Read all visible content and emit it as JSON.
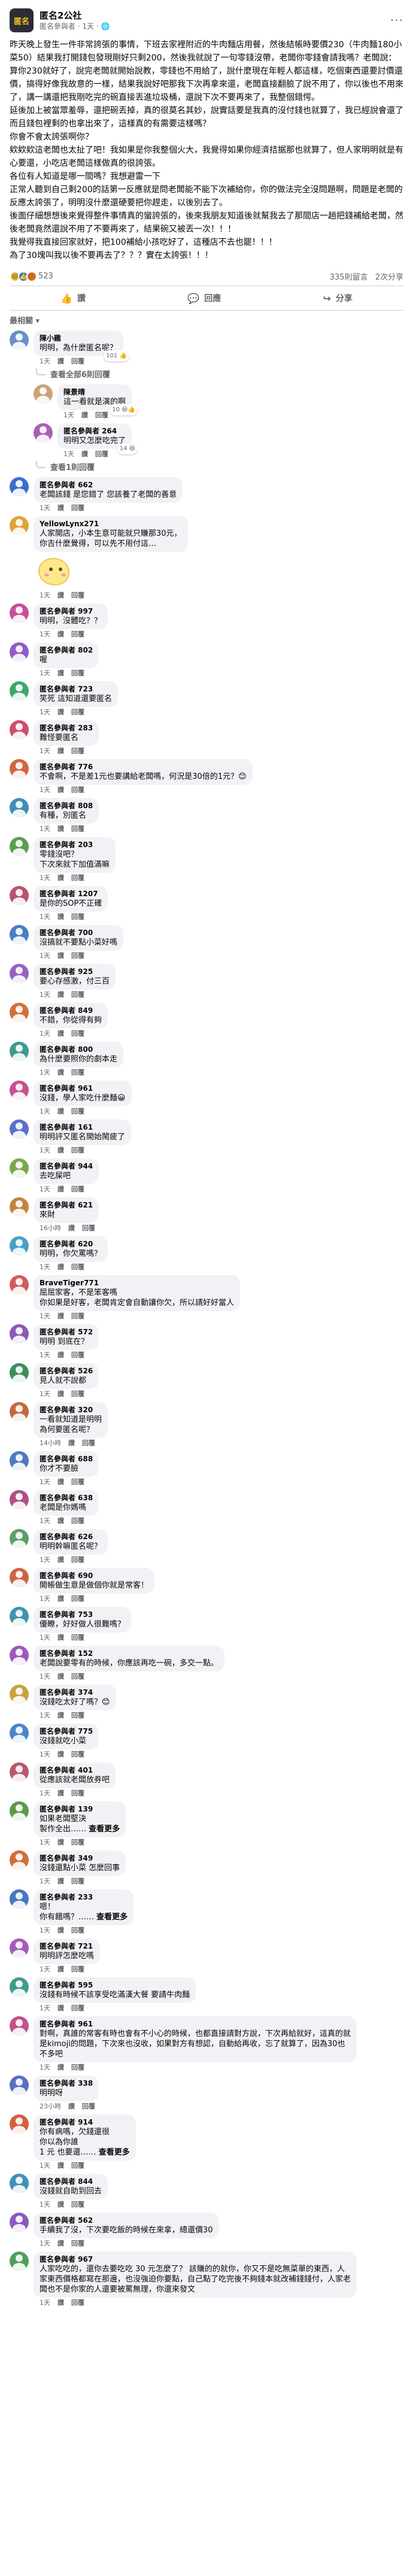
{
  "post": {
    "group_name": "匿名2公社",
    "author": "匿名參與者",
    "time": "1天",
    "paragraphs": [
      "昨天晚上發生一件非常誇張的事情，下班去家裡附近的牛肉麵店用餐，然後結帳時要價230（牛肉麵180小菜50）結果我打開錢包發現剛好只剩200，然後我就說了一句零錢沒帶，老闆你零錢會請我嗎？老闆說：算你230就好了，說完老闆就開始說教，零錢也不用給了，說什麼現在年輕人都這樣，吃個東西還要討價還價，搞得好像我故意的一樣，結果我說好吧那我下次再拿來還，老闆直接翻臉了說不用了，你以後也不用來了，講一講還把我剛吃完的碗直接丟進垃圾桶，還說下次不要再來了，我整個錯愕。",
      "延後加上被當眾羞辱，還把碗丟掉，真的很莫名其妙，說實話要是我真的沒付錢也就算了，我已經說會還了而且錢包裡剩的也拿出來了，這樣真的有需要這樣嗎？",
      "你會不會太誇張啊你？",
      "欸欸欸這老闆也太扯了吧！我如果是你我整個火大，我覺得如果你經濟拮据那也就算了，但人家明明就是有心要還，小吃店老闆這樣做真的很誇張。",
      "各位有人知道是哪一間嗎？我想避雷一下",
      "正常人聽到自己剩200的話第一反應就是問老闆能不能下次補給你，你的做法完全沒問題啊，問題是老闆的反應太誇張了，明明沒什麼還硬要把你趕走，以後別去了。",
      "後面仔細想想後來覺得整件事情真的蠻誇張的，後來我朋友知道後就幫我去了那間店一趟把錢補給老闆，然後老闆竟然還說不用了不要再來了，結果碗又被丟一次！！！",
      "我覺得我直接回家就好，把100補給小孩吃好了，這種店不去也罷！！！",
      "為了30塊叫我以後不要再去了？？？實在太誇張！！！"
    ],
    "reaction_count": "523",
    "comment_count": "335則留言",
    "share_count": "2次分享",
    "like_label": "讚",
    "comment_label": "回應",
    "share_label": "分享",
    "sort_label": "最相關 ▾",
    "icons": {
      "more": "more-horizontal-icon",
      "like": "thumbs-up-icon",
      "comment": "speech-bubble-icon",
      "share": "share-arrow-icon"
    }
  },
  "view_replies": [
    "查看全部6則回覆",
    "查看1則回覆"
  ],
  "comments": [
    {
      "name": "陳小雞",
      "text": "明明，為什麼匿名呢？",
      "time": "1天",
      "reply": false,
      "react": "101 👍",
      "color": "#6b8fc7"
    },
    {
      "name": "陳景晴",
      "text": "這一看就是演的啊",
      "time": "1天",
      "reply": true,
      "react": "10 😆👍",
      "color": "#c9a27a"
    },
    {
      "name": "匿名參與者 264",
      "text": "明明又怎麼吃完了",
      "time": "1天",
      "reply": true,
      "react": "14 😆",
      "color": "#a85fb5"
    },
    {
      "name": "匿名參與者 662",
      "text": "老闆該錢 是您錯了 您該養了老闆的善意",
      "time": "1天",
      "reply": false,
      "react": "",
      "color": "#3d6ecf"
    },
    {
      "name": "YellowLynx271",
      "text": "人家開店，小本生意可能就只賺那30元，\n你吉什麼覺得，可以先不用付這…",
      "time": "1天",
      "reply": false,
      "react": "",
      "color": "#e0a33a",
      "sticker": true
    },
    {
      "name": "匿名參與者 997",
      "text": "明明，沒體吃？？",
      "time": "1天",
      "reply": false,
      "react": "",
      "color": "#c74f9a"
    },
    {
      "name": "匿名參與者 802",
      "text": "喔",
      "time": "1天",
      "reply": false,
      "react": "",
      "color": "#8e5cc9"
    },
    {
      "name": "匿名參與者 723",
      "text": "笑死 這知道還要匿名",
      "time": "1天",
      "reply": false,
      "react": "",
      "color": "#3fa66b"
    },
    {
      "name": "匿名參與者 283",
      "text": "難怪要匿名",
      "time": "1天",
      "reply": false,
      "react": "",
      "color": "#c94f6d"
    },
    {
      "name": "匿名參與者 776",
      "text": "不會啊，不是差1元也要講給老闆嗎，何況是30倍的1元？😊",
      "time": "1天",
      "reply": false,
      "react": "",
      "color": "#d1683b"
    },
    {
      "name": "匿名參與者 808",
      "text": "有種，別匿名",
      "time": "1天",
      "reply": false,
      "react": "",
      "color": "#3f8fb5"
    },
    {
      "name": "匿名參與者 203",
      "text": "零錢沒吧？\n下次來就下加值滿嘛",
      "time": "1天",
      "reply": false,
      "react": "",
      "color": "#5a9e4f"
    },
    {
      "name": "匿名參與者 1207",
      "text": "是你的SOP不正確",
      "time": "1天",
      "reply": false,
      "react": "",
      "color": "#b8546a"
    },
    {
      "name": "匿名參與者 700",
      "text": "沒搞就不要點小菜好嗎",
      "time": "1天",
      "reply": false,
      "react": "",
      "color": "#4a7ec4"
    },
    {
      "name": "匿名參與者 925",
      "text": "要心存感激，付三百",
      "time": "1天",
      "reply": false,
      "react": "",
      "color": "#9463c2"
    },
    {
      "name": "匿名參與者 849",
      "text": "不錯，你從得有夠",
      "time": "1天",
      "reply": false,
      "react": "",
      "color": "#d0713a"
    },
    {
      "name": "匿名參與者 800",
      "text": "為什麼要照你的劇本走",
      "time": "1天",
      "reply": false,
      "react": "",
      "color": "#3b9c8e"
    },
    {
      "name": "匿名參與者 961",
      "text": "沒錢，學人家吃什麼麵😀",
      "time": "1天",
      "reply": false,
      "react": "",
      "color": "#c45390"
    },
    {
      "name": "匿名參與者 161",
      "text": "明明評又匿名開始鬧疲了",
      "time": "1天",
      "reply": false,
      "react": "",
      "color": "#5c6fc8"
    },
    {
      "name": "匿名參與者 944",
      "text": "去吃屎吧",
      "time": "1天",
      "reply": false,
      "react": "",
      "color": "#7aa84a"
    },
    {
      "name": "匿名參與者 621",
      "text": "來財",
      "time": "16小時",
      "reply": false,
      "react": "",
      "color": "#c4843a"
    },
    {
      "name": "匿名參與者 620",
      "text": "明明，你欠罵嗎？",
      "time": "1天",
      "reply": false,
      "react": "",
      "color": "#49a0c7"
    },
    {
      "name": "BraveTiger771",
      "text": "屈屈家客，不是笨客嗎\n你如果是好客，老闆肯定會自動讓你欠，所以請好好當人",
      "time": "1天",
      "reply": false,
      "react": "",
      "color": "#d25a5a"
    },
    {
      "name": "匿名參與者 572",
      "text": "明明 到底在？",
      "time": "1天",
      "reply": false,
      "react": "",
      "color": "#8d5ab8"
    },
    {
      "name": "匿名參與者 526",
      "text": "見人就不說都",
      "time": "1天",
      "reply": false,
      "react": "",
      "color": "#3e8d5d"
    },
    {
      "name": "匿名參與者 320",
      "text": "一看就知道是明明\n為何要匿名呢？",
      "time": "14小時",
      "reply": false,
      "react": "",
      "color": "#c26a3e"
    },
    {
      "name": "匿名參與者 688",
      "text": "你才不要臉",
      "time": "1天",
      "reply": false,
      "react": "",
      "color": "#4e78c0"
    },
    {
      "name": "匿名參與者 638",
      "text": "老闆是你媽嗎",
      "time": "1天",
      "reply": false,
      "react": "",
      "color": "#b04f88"
    },
    {
      "name": "匿名參與者 626",
      "text": "明明幹嘛匿名呢？",
      "time": "1天",
      "reply": false,
      "react": "",
      "color": "#5aa06a"
    },
    {
      "name": "匿名參與者 690",
      "text": "開帳做生意是做個你就是常客！",
      "time": "1天",
      "reply": false,
      "react": "",
      "color": "#ca6544"
    },
    {
      "name": "匿名參與者 753",
      "text": "優瞭，好好做人很難嗎？",
      "time": "1天",
      "reply": false,
      "react": "",
      "color": "#3f94ad"
    },
    {
      "name": "匿名參與者 152",
      "text": "老闆說要零有的時候，你應該再吃一碗，多交一點。",
      "time": "1天",
      "reply": false,
      "react": "",
      "color": "#9a59bf"
    },
    {
      "name": "匿名參與者 374",
      "text": "沒錢吃太好了嗎？😊",
      "time": "1天",
      "reply": false,
      "react": "",
      "color": "#c9a23e"
    },
    {
      "name": "匿名參與者 775",
      "text": "沒錢就吃小菜",
      "time": "1天",
      "reply": false,
      "react": "",
      "color": "#4b86c9"
    },
    {
      "name": "匿名參與者 401",
      "text": "從應該就老闆放券吧",
      "time": "1天",
      "reply": false,
      "react": "",
      "color": "#b8586f"
    },
    {
      "name": "匿名參與者 139",
      "text": "如果老闆堅決\n製作全出……",
      "time": "1天",
      "reply": false,
      "react": "",
      "color": "#5d9a45",
      "more": true
    },
    {
      "name": "匿名參與者 349",
      "text": "沒錢還點小菜 怎麼回事",
      "time": "1天",
      "reply": false,
      "react": "",
      "color": "#cf6f3a"
    },
    {
      "name": "匿名參與者 233",
      "text": "嗯！\n你有餓嗎？……",
      "time": "1天",
      "reply": false,
      "react": "",
      "color": "#4677bd",
      "more": true
    },
    {
      "name": "匿名參與者 721",
      "text": "明明評怎麼吃嗎",
      "time": "1天",
      "reply": false,
      "react": "",
      "color": "#a55cb8"
    },
    {
      "name": "匿名參與者 595",
      "text": "沒錢有時候不該享受吃滿漢大餐 要請牛肉麵",
      "time": "1天",
      "reply": false,
      "react": "",
      "color": "#3f9b8a"
    },
    {
      "name": "匿名參與者 961",
      "text": "對啊，真誰的常客有時也會有不小心的時候，也都直接請對方說，下次再給就好，這真的就是kimoji的問題，下次來也沒收，如果對方有想認，自動給再收，忘了就算了，因為30也不多吧",
      "time": "1天",
      "reply": false,
      "react": "",
      "color": "#c4508f"
    },
    {
      "name": "匿名參與者 338",
      "text": "明明呀",
      "time": "23小時",
      "reply": false,
      "react": "",
      "color": "#5a6fc2"
    },
    {
      "name": "匿名參與者 914",
      "text": "你有病嗎，欠錢還很\n你以為你誰\n1 元 也要還……",
      "time": "1天",
      "reply": false,
      "react": "",
      "color": "#d26140",
      "more": true
    },
    {
      "name": "匿名參與者 844",
      "text": "沒錢就自助到回去",
      "time": "1天",
      "reply": false,
      "react": "",
      "color": "#3d92b8"
    },
    {
      "name": "匿名參與者 562",
      "text": "手續我了沒，下次要吃飯的時候在來拿，總還價30",
      "time": "1天",
      "reply": false,
      "react": "",
      "color": "#8b59c0"
    },
    {
      "name": "匿名參與者 967",
      "text": "人家吃吃的，還你去要吃吃 30 元怎麼了？ 該賺的的就你，你又不是吃無菜單的東西，人家東西價格都寫在那邊，也沒強迫你要點，自己點了吃完後不夠錢本就改補錢錢付，人家老闆也不是你家的人還要被罵無理，你還來發文",
      "time": "1天",
      "reply": false,
      "react": "",
      "color": "#4fa05c"
    }
  ],
  "meta_labels": {
    "like": "讚",
    "reply": "回覆"
  }
}
